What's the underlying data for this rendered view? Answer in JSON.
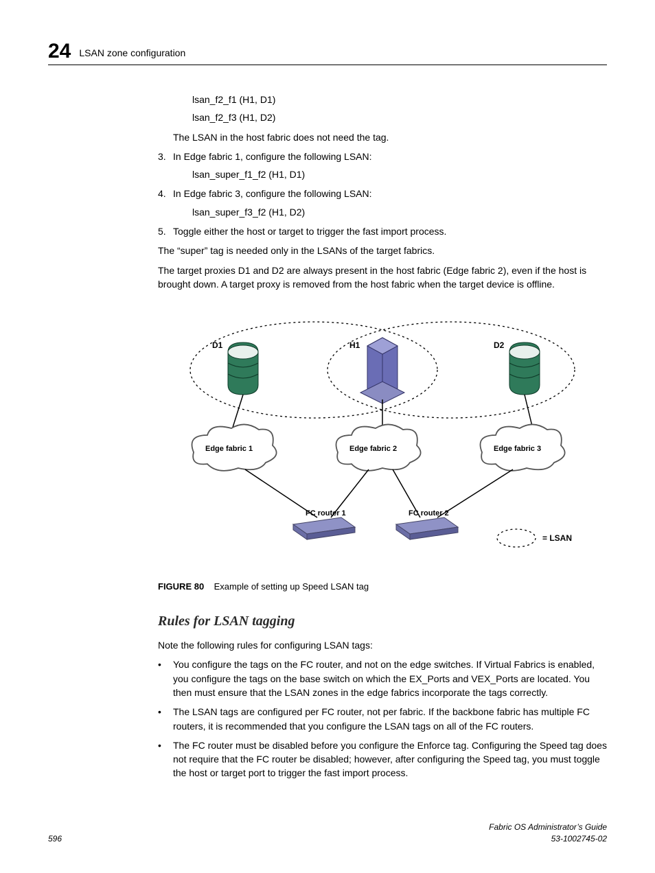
{
  "header": {
    "chapter_number": "24",
    "title": "LSAN zone configuration"
  },
  "code_lines_top": [
    "lsan_f2_f1 (H1, D1)",
    "lsan_f2_f3 (H1, D2)"
  ],
  "para_host_fabric": "The LSAN in the host fabric does not need the tag.",
  "step3": {
    "num": "3.",
    "text": "In Edge fabric 1, configure the following LSAN:",
    "code": "lsan_super_f1_f2 (H1, D1)"
  },
  "step4": {
    "num": "4.",
    "text": "In Edge fabric 3, configure the following LSAN:",
    "code": "lsan_super_f3_f2 (H1, D2)"
  },
  "step5": {
    "num": "5.",
    "text": "Toggle either the host or target to trigger the fast import process."
  },
  "para_super_tag": "The “super” tag is needed only in the LSANs of the target fabrics.",
  "para_target_proxies": "The target proxies D1 and D2 are always present in the host fabric (Edge fabric 2), even if the host is brought down. A target proxy is removed from the host fabric when the target device is offline.",
  "diagram": {
    "d1": "D1",
    "h1": "H1",
    "d2": "D2",
    "edge1": "Edge fabric 1",
    "edge2": "Edge fabric 2",
    "edge3": "Edge fabric 3",
    "fc1": "FC router 1",
    "fc2": "FC router 2",
    "lsan_legend": "= LSAN"
  },
  "figure": {
    "label": "FIGURE 80",
    "caption": "Example of setting up Speed LSAN tag"
  },
  "h3_rules": "Rules for LSAN tagging",
  "para_rules_intro": "Note the following rules for configuring LSAN tags:",
  "bullets": [
    "You configure the tags on the FC router, and not on the edge switches. If Virtual Fabrics is enabled, you configure the tags on the base switch on which the EX_Ports and VEX_Ports are located. You then must ensure that the LSAN zones in the edge fabrics incorporate the tags correctly.",
    "The LSAN tags are configured per FC router, not per fabric. If the backbone fabric has multiple FC routers, it is recommended that you configure the LSAN tags on all of the FC routers.",
    "The FC router must be disabled before you configure the Enforce tag. Configuring the Speed tag does not require that the FC router be disabled; however, after configuring the Speed tag, you must toggle the host or target port to trigger the fast import process."
  ],
  "footer": {
    "page": "596",
    "doc_title": "Fabric OS Administrator’s Guide",
    "doc_num": "53-1002745-02"
  }
}
